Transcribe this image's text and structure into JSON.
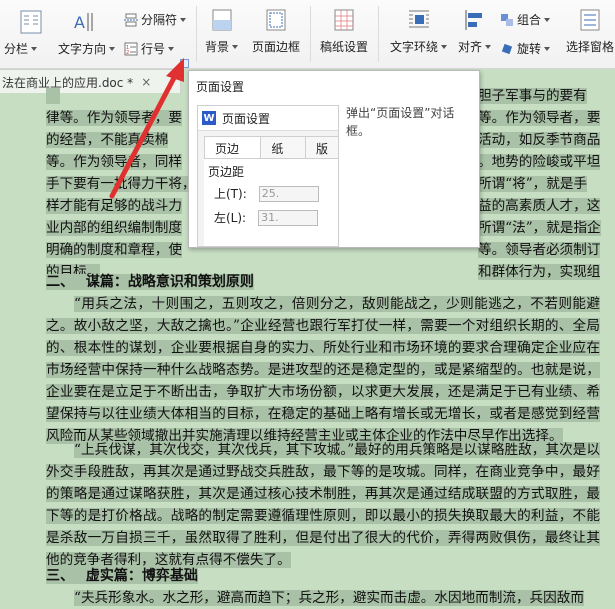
{
  "toolbar": {
    "fen_lan": "分栏",
    "text_direction": "文字方向",
    "separator": "分隔符",
    "line_number": "行号",
    "background": "背景",
    "page_border": "页面边框",
    "manuscript": "稿纸设置",
    "text_wrap": "文字环绕",
    "align": "对齐",
    "group": "组合",
    "rotate": "旋转",
    "selection_pane": "选择窗格"
  },
  "document_tab": {
    "name": "法在商业上的应用.doc *",
    "close": "×"
  },
  "tooltip": {
    "title": "页面设置",
    "description": "弹出“页面设置”对话框。",
    "preview": {
      "dialog_title": "页面设置",
      "logo": "W",
      "tabs": [
        "页边距",
        "纸张",
        "版"
      ],
      "section": "页边距",
      "top_label": "上(T):",
      "top_value": "25.",
      "left_label": "左(L):",
      "left_value": "31."
    }
  },
  "document": {
    "lines_top": [
      "的经营，不能真卖棉",
      "等。作为领导者，同样",
      "手下要有一批得力干将，",
      "样才能有足够的战斗力",
      "业内部的组织编制制度",
      "明确的制度和章程，使",
      "的目标。"
    ],
    "right_fragments": [
      "胆子军事与的要有",
      "等。作为领导者，要",
      "活动，如反季节商品",
      "。地势的险峻或平坦",
      "所谓“将”，就是手",
      "益的高素质人才，这",
      "所谓“法”，就是指企",
      "等。领导者必须制订",
      "和群体行为，实现组"
    ],
    "line_first": "律等。作为领导者，要",
    "heading2": "二、　  谋篇：战略意识和策划原则",
    "para2": "“用兵之法，十则围之，五则攻之，倍则分之，敌则能战之，少则能逃之，不若则能避之。故小敌之坚，大敌之擒也。”企业经营也跟行军打仗一样，需要一个对组织长期的、全局的、根本性的谋划，企业要根据自身的实力、所处行业和市场环境的要求合理确定企业应在市场经营中保持一种什么战略态势。是进攻型的还是稳定型的，或是紧缩型的。也就是说，企业要在是立足于不断出击，争取扩大市场份额，以求更大发展，还是满足于已有业绩、希望保持与以往业绩大体相当的目标，在稳定的基础上略有增长或无增长，或者是感觉到经营风险而从某些领域撤出并实施清理以维持经营主业或主体企业的作法中尽早作出选择。",
    "para3": "“上兵伐谋，其次伐交，其次伐兵，其下攻城。”最好的用兵策略是以谋略胜敌，其次是以外交手段胜敌，再其次是通过野战交兵胜敌，最下等的是攻城。同样，在商业竞争中，最好的策略是通过谋略获胜，其次是通过核心技术制胜，再其次是通过结成联盟的方式取胜，最下等的是打价格战。战略的制定需要遵循理性原则，即以最小的损失换取最大的利益，不能是杀敌一万自损三千，虽然取得了胜利，但是付出了很大的代价，弄得两败俱伤，最终让其他的竞争者得利，这就有点得不偿失了。",
    "heading3": "三、　  虚实篇：博弈基础",
    "para4": "“夫兵形象水。水之形，避高而趋下；兵之形，避实而击虚。水因地而制流，兵因敌而"
  },
  "colors": {
    "doc_bg": "#c7dec3",
    "highlight": "#a9c1a6",
    "arrow": "#e03030"
  }
}
